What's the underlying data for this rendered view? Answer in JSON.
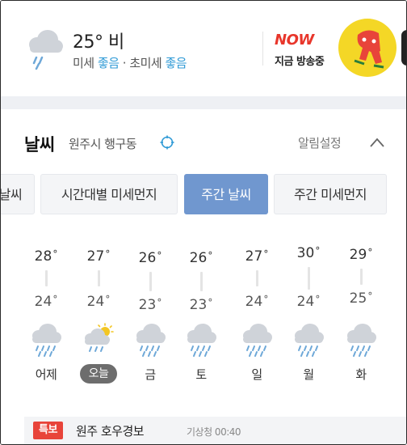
{
  "header": {
    "temperature": "25° 비",
    "air_fine_label": "미세",
    "air_fine_value": "좋음",
    "air_sep": " · ",
    "air_ultra_label": "초미세",
    "air_ultra_value": "좋음",
    "now_title": "NOW",
    "now_subtitle": "지금 방송중"
  },
  "weather": {
    "title": "날씨",
    "location": "원주시 행구동",
    "alarm_label": "알림설정",
    "tabs": [
      {
        "label": "날씨",
        "active": false
      },
      {
        "label": "시간대별 미세먼지",
        "active": false
      },
      {
        "label": "주간 날씨",
        "active": true
      },
      {
        "label": "주간 미세먼지",
        "active": false
      }
    ],
    "days": [
      {
        "name": "어제",
        "high": "28",
        "low": "24",
        "icon": "rain-cloud-icon",
        "today": false
      },
      {
        "name": "오늘",
        "high": "27",
        "low": "24",
        "icon": "sun-cloud-rain-icon",
        "today": true
      },
      {
        "name": "금",
        "high": "26",
        "low": "23",
        "icon": "rain-cloud-icon",
        "today": false
      },
      {
        "name": "토",
        "high": "26",
        "low": "23",
        "icon": "rain-cloud-icon",
        "today": false
      },
      {
        "name": "일",
        "high": "27",
        "low": "24",
        "icon": "rain-cloud-icon",
        "today": false
      },
      {
        "name": "월",
        "high": "30",
        "low": "24",
        "icon": "rain-cloud-icon",
        "today": false
      },
      {
        "name": "화",
        "high": "29",
        "low": "25",
        "icon": "rain-cloud-icon",
        "today": false
      }
    ],
    "alert": {
      "badge": "특보",
      "text": "원주 호우경보",
      "source": "기상청 00:40"
    }
  },
  "colors": {
    "accent_blue": "#2f9ad6",
    "tab_active": "#7097cf",
    "badge_red": "#e8443a",
    "now_red": "#e8362b",
    "now_yellow": "#f4d726"
  }
}
